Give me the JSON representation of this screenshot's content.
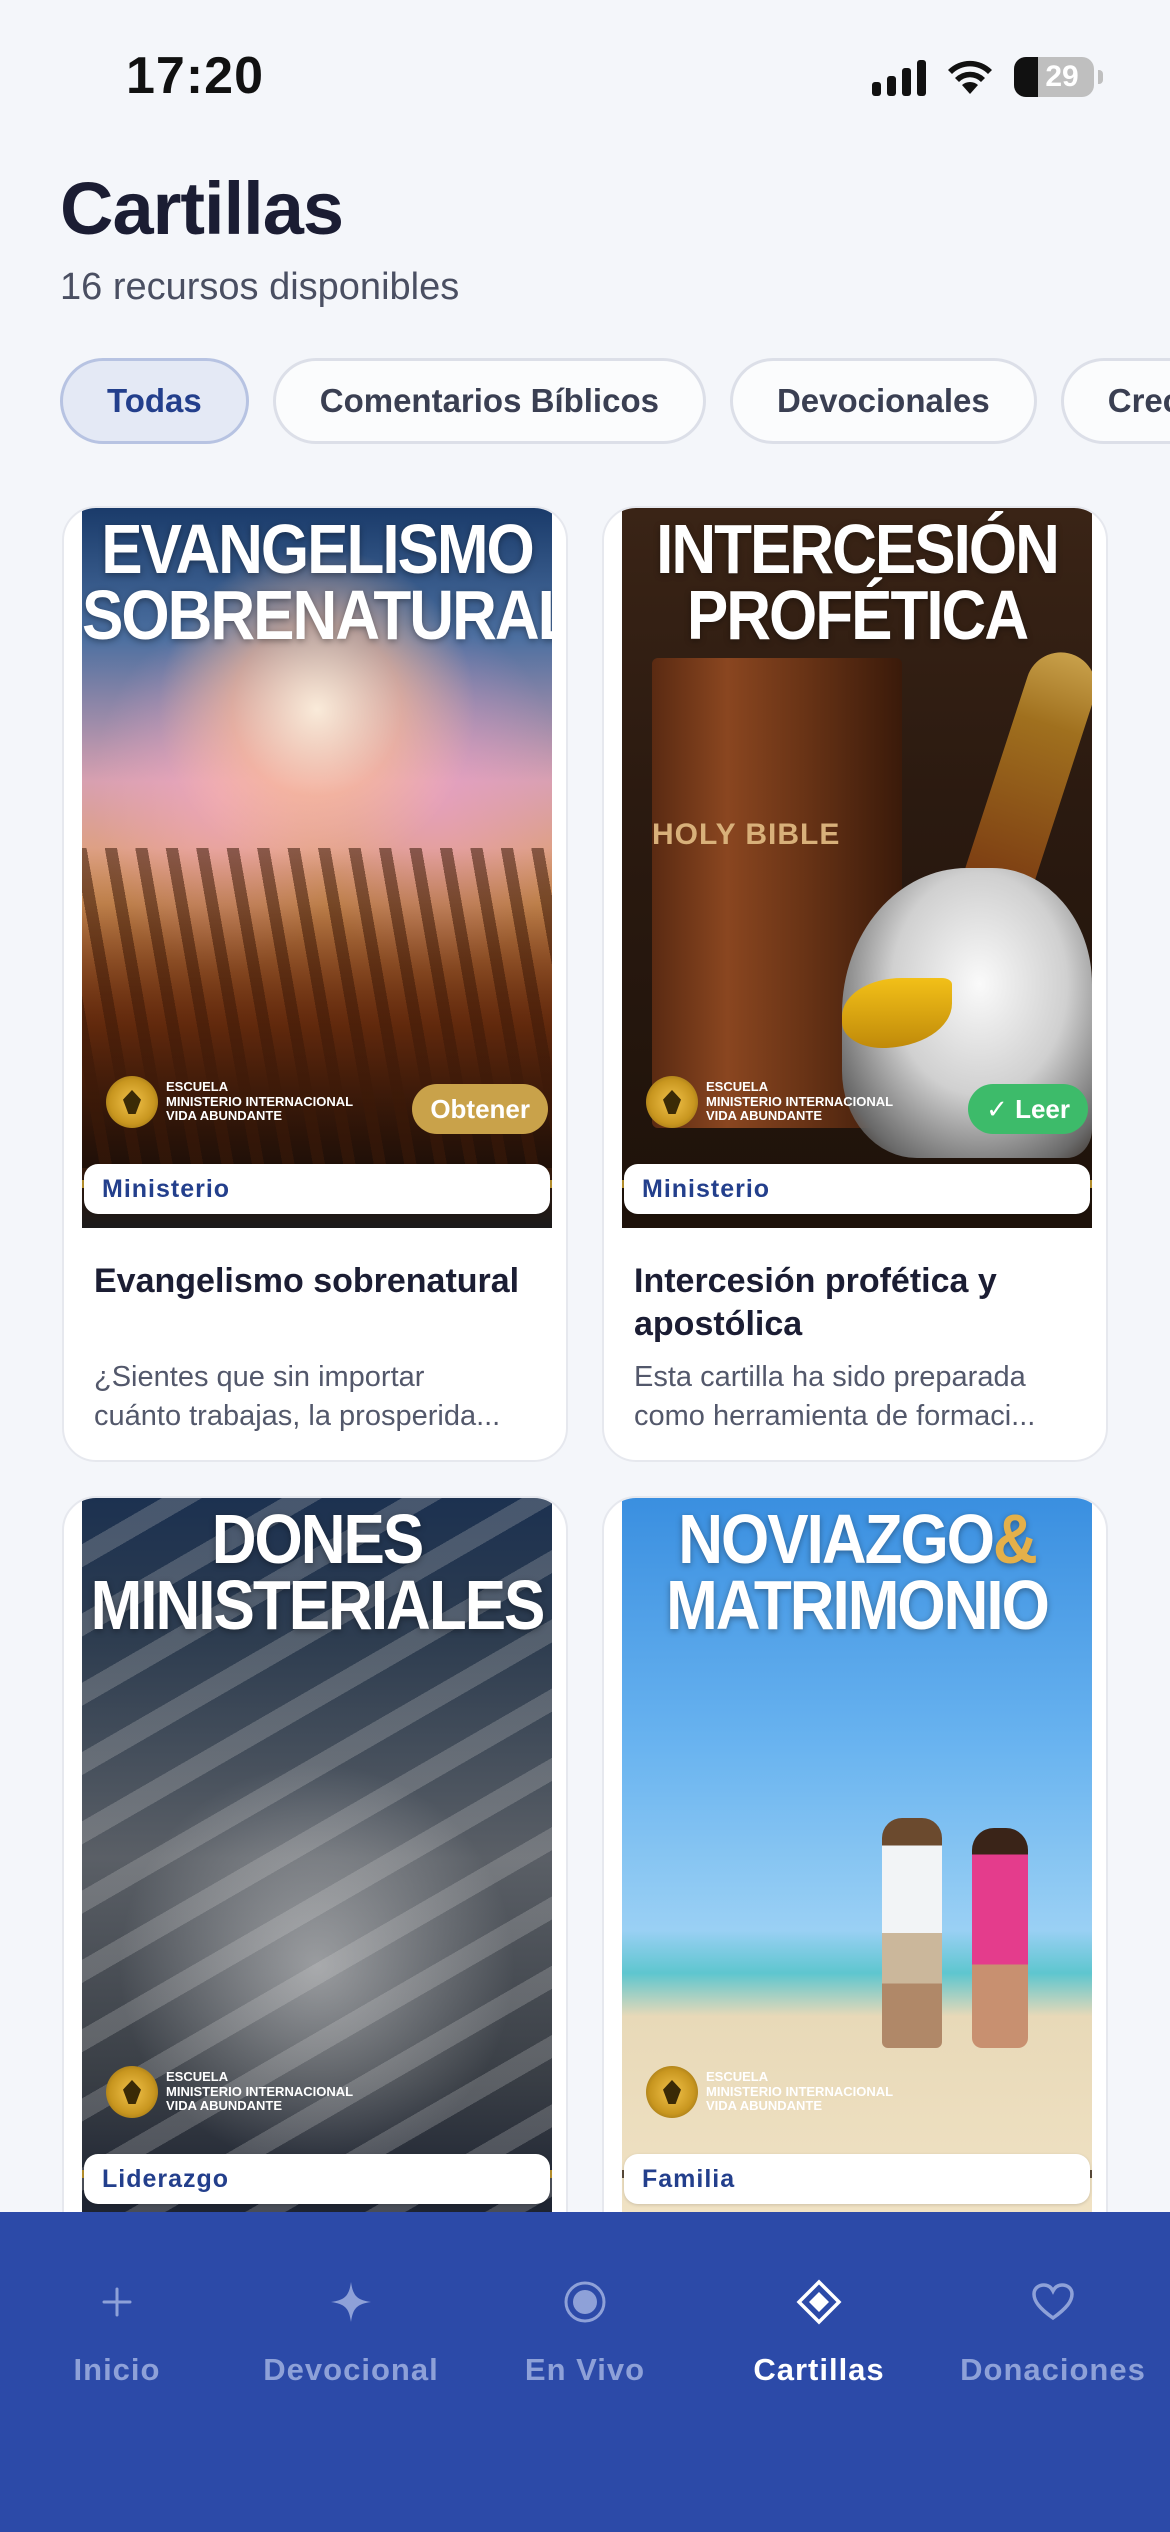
{
  "status_bar": {
    "time": "17:20",
    "battery": "29"
  },
  "header": {
    "title": "Cartillas",
    "subtitle": "16 recursos disponibles"
  },
  "filters": [
    {
      "label": "Todas",
      "active": true
    },
    {
      "label": "Comentarios Bíblicos",
      "active": false
    },
    {
      "label": "Devocionales",
      "active": false
    },
    {
      "label": "Creci",
      "active": false
    }
  ],
  "cards": [
    {
      "cover_title_1": "EVANGELISMO",
      "cover_title_2": "SOBRENATURAL",
      "category": "Ministerio",
      "action": "Obtener",
      "title": "Evangelismo sobrenatural",
      "desc_1": "¿Sientes que sin importar",
      "desc_2": "cuánto trabajas, la prosperida..."
    },
    {
      "cover_title_1": "INTERCESIÓN",
      "cover_title_2": "PROFÉTICA",
      "cover_book_label": "HOLY BIBLE",
      "category": "Ministerio",
      "action": "✓ Leer",
      "title": "Intercesión profética y apostólica",
      "desc_1": "Esta cartilla ha sido preparada",
      "desc_2": "como herramienta de formaci..."
    },
    {
      "cover_title_1": "DONES",
      "cover_title_2": "MINISTERIALES",
      "category": "Liderazgo"
    },
    {
      "cover_title_1": "NOVIAZGO",
      "cover_title_amp": "&",
      "cover_title_2": "MATRIMONIO",
      "category": "Familia"
    }
  ],
  "cover_branding": {
    "school_line_1": "ESCUELA",
    "school_line_2": "MINISTERIO INTERNACIONAL",
    "school_line_3": "VIDA ABUNDANTE"
  },
  "tab_bar": {
    "items": [
      {
        "label": "Inicio",
        "icon": "sparkle-small-icon",
        "active": false
      },
      {
        "label": "Devocional",
        "icon": "sparkle-icon",
        "active": false
      },
      {
        "label": "En Vivo",
        "icon": "live-dot-icon",
        "active": false
      },
      {
        "label": "Cartillas",
        "icon": "diamond-icon",
        "active": true
      },
      {
        "label": "Donaciones",
        "icon": "heart-icon",
        "active": false
      }
    ]
  },
  "colors": {
    "accent": "#233f8c",
    "tab_bar_bg": "#2c4aa8",
    "obtain_badge": "#c9a24a",
    "read_badge": "#3dbb6a"
  }
}
